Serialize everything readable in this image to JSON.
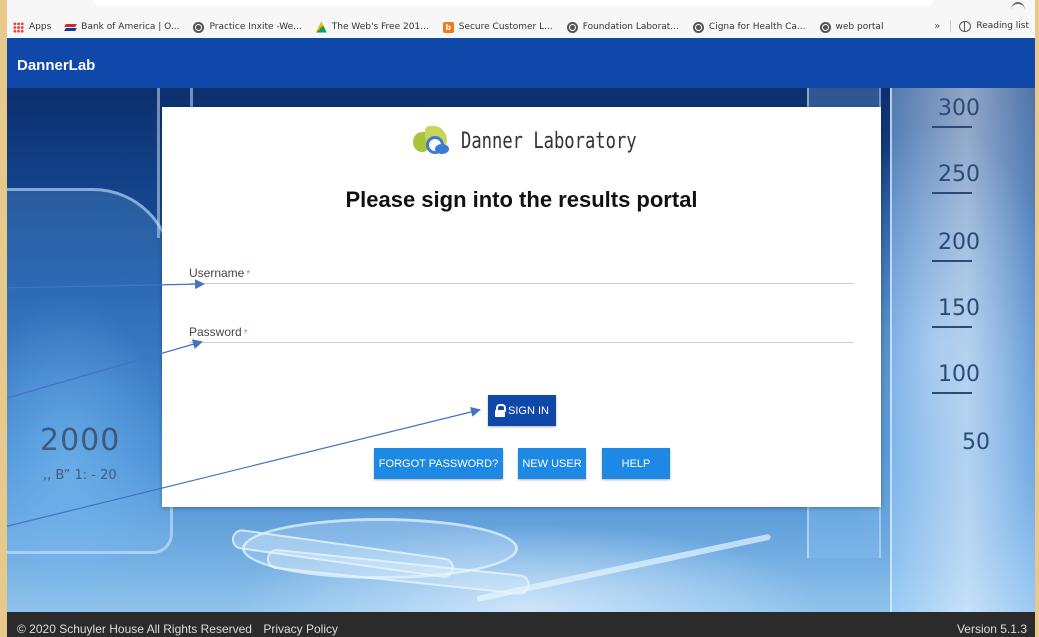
{
  "bookmarks": {
    "items": [
      {
        "label": "Apps",
        "icon": "apps-grid-icon"
      },
      {
        "label": "Bank of America | O...",
        "icon": "bank-of-america-icon"
      },
      {
        "label": "Practice Inxite -We...",
        "icon": "globe-icon"
      },
      {
        "label": "The Web's Free 201...",
        "icon": "pyramid-icon"
      },
      {
        "label": "Secure Customer L...",
        "icon": "b-letter-icon"
      },
      {
        "label": "Foundation Laborat...",
        "icon": "globe-icon"
      },
      {
        "label": "Cigna for Health Ca...",
        "icon": "globe-icon"
      },
      {
        "label": "web portal",
        "icon": "globe-icon"
      }
    ],
    "more": "»",
    "reading_list": "Reading list"
  },
  "header": {
    "brand": "DannerLab",
    "color": "#0f48a9"
  },
  "card": {
    "logo_text": "Danner Laboratory",
    "title": "Please sign into the results portal",
    "username_label": "Username",
    "password_label": "Password",
    "required_mark": "*",
    "signin_label": "SIGN IN",
    "forgot_label": "FORGOT PASSWORD?",
    "new_user_label": "NEW USER",
    "help_label": "HELP"
  },
  "background": {
    "cylinder_marks": [
      "300",
      "250",
      "200",
      "150",
      "100",
      "50"
    ],
    "beaker_text": "2000",
    "beaker_subtext": ",, B” 1:  - 20"
  },
  "footer": {
    "copyright": "© 2020 Schuyler House All Rights Reserved",
    "privacy": "Privacy Policy",
    "version": "Version 5.1.3"
  },
  "colors": {
    "primary": "#0f48a9",
    "accent": "#1e88e5",
    "footer": "#2b2b2b"
  }
}
